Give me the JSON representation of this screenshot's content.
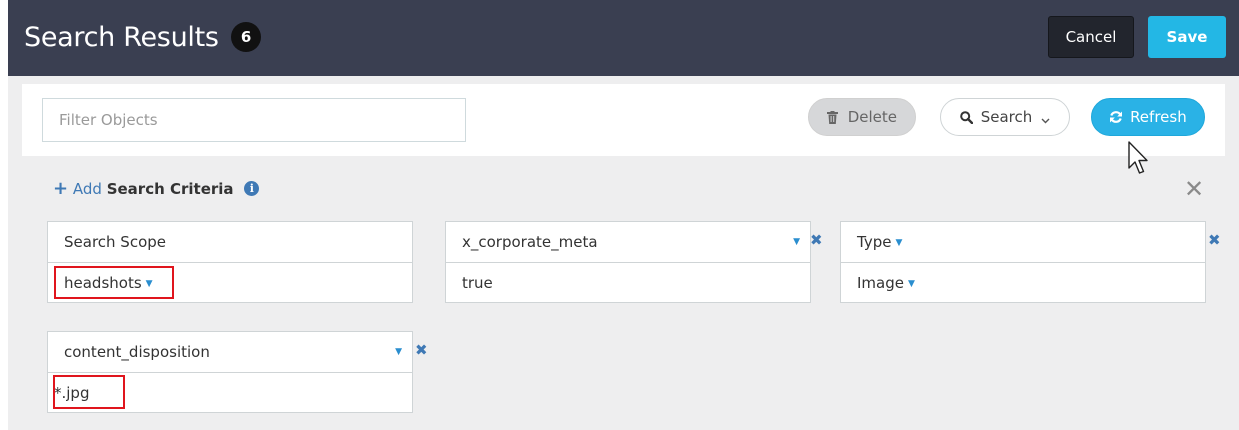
{
  "header": {
    "title": "Search Results",
    "count": "6",
    "cancel_label": "Cancel",
    "save_label": "Save"
  },
  "toolbar": {
    "filter_placeholder": "Filter Objects",
    "delete_label": "Delete",
    "search_label": "Search",
    "refresh_label": "Refresh"
  },
  "criteria": {
    "add_label": "Add",
    "section_label": "Search Criteria",
    "cards": [
      {
        "field": "Search Scope",
        "value": "headshots"
      },
      {
        "field": "x_corporate_meta",
        "value": "true"
      },
      {
        "field": "Type",
        "value": "Image"
      },
      {
        "field": "content_disposition",
        "value": "*.jpg"
      }
    ]
  },
  "colors": {
    "header_bg": "#3a3f51",
    "accent": "#23b7e5",
    "link": "#3f79b5",
    "highlight": "#e0151d"
  },
  "icons": [
    "trash-icon",
    "search-icon",
    "chevron-down-icon",
    "refresh-icon",
    "plus-icon",
    "info-icon",
    "close-icon",
    "remove-icon",
    "caret-down-icon",
    "mouse-cursor-icon"
  ]
}
